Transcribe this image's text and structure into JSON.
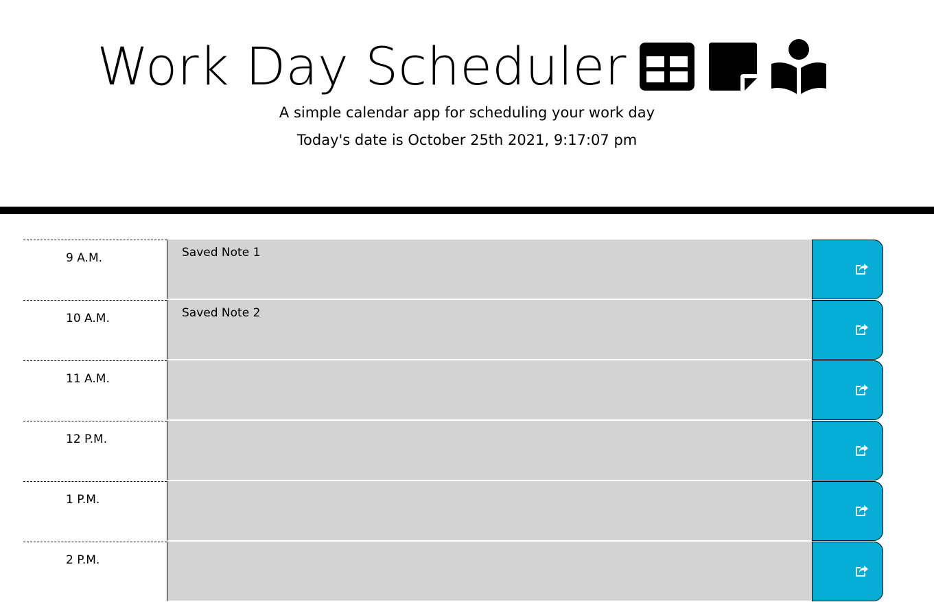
{
  "header": {
    "title": "Work Day Scheduler",
    "subtitle": "A simple calendar app for scheduling your work day",
    "date_text": "Today's date is October 25th 2021, 9:17:07 pm",
    "icons": [
      "table-icon",
      "sticky-note-icon",
      "book-reader-icon"
    ]
  },
  "colors": {
    "past_row": "#d3d3d3",
    "save_button": "#06aed5",
    "divider": "#000000"
  },
  "schedule": {
    "rows": [
      {
        "hour": "9 A.M.",
        "note": "Saved Note 1"
      },
      {
        "hour": "10 A.M.",
        "note": "Saved Note 2"
      },
      {
        "hour": "11 A.M.",
        "note": ""
      },
      {
        "hour": "12 P.M.",
        "note": ""
      },
      {
        "hour": "1 P.M.",
        "note": ""
      },
      {
        "hour": "2 P.M.",
        "note": ""
      }
    ],
    "save_icon": "share-square-icon"
  }
}
